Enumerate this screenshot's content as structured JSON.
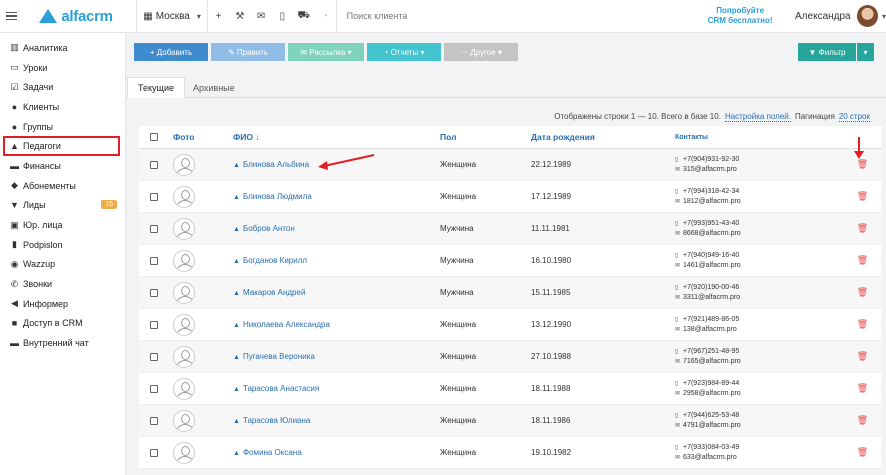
{
  "topbar": {
    "logo": "alfacrm",
    "city": "Москва",
    "search_placeholder": "Поиск клиента",
    "promo_line1": "Попробуйте",
    "promo_line2": "CRM бесплатно!",
    "user": "Александра",
    "icons": [
      "plus-icon",
      "wrench-icon",
      "mail-icon",
      "phone-icon",
      "cart-icon",
      "bell-icon"
    ]
  },
  "sidebar": {
    "items": [
      {
        "label": "Аналитика",
        "icon": "bars-icon"
      },
      {
        "label": "Уроки",
        "icon": "book-icon"
      },
      {
        "label": "Задачи",
        "icon": "tasks-icon"
      },
      {
        "label": "Клиенты",
        "icon": "user-icon"
      },
      {
        "label": "Группы",
        "icon": "users-icon"
      },
      {
        "label": "Педагоги",
        "icon": "graduation-cap-icon"
      },
      {
        "label": "Финансы",
        "icon": "money-icon"
      },
      {
        "label": "Абонементы",
        "icon": "tag-icon"
      },
      {
        "label": "Лиды",
        "icon": "filter-icon",
        "badge": "15"
      },
      {
        "label": "Юр. лица",
        "icon": "briefcase-icon"
      },
      {
        "label": "Podpislon",
        "icon": "doc-icon"
      },
      {
        "label": "Wazzup",
        "icon": "whatsapp-icon"
      },
      {
        "label": "Звонки",
        "icon": "phone-icon"
      },
      {
        "label": "Информер",
        "icon": "bullhorn-icon"
      },
      {
        "label": "Доступ в CRM",
        "icon": "lock-icon"
      },
      {
        "label": "Внутренний чат",
        "icon": "chat-icon"
      }
    ]
  },
  "toolbar": {
    "add": "+ Добавить",
    "edit": "✎ Править",
    "mail": "✉ Рассылка ▾",
    "reports": "◔ Отчеты ▾",
    "other": "··· Другое ▾",
    "filter": "▼ Фильтр",
    "filter_dd": "▾"
  },
  "tabs": [
    "Текущие",
    "Архивные"
  ],
  "pagination": {
    "text": "Отображены строки 1 — 10. Всего в базе 10.",
    "fields_link": "Настройка полей.",
    "pag_label": "Пагинация",
    "pag_link": "20 строк"
  },
  "table": {
    "columns": [
      "Фото",
      "ФИО ↓",
      "Пол",
      "Дата рождения",
      "Контакты"
    ],
    "rows": [
      {
        "name": "Блинова Альбина",
        "sex": "Женщина",
        "birth": "22.12.1989",
        "phone": "+7(904)931-92-30",
        "email": "315@alfacrm.pro"
      },
      {
        "name": "Блинова Людмила",
        "sex": "Женщина",
        "birth": "17.12.1989",
        "phone": "+7(994)318-42-34",
        "email": "1812@alfacrm.pro"
      },
      {
        "name": "Бобров Антон",
        "sex": "Мужчина",
        "birth": "11.11.1981",
        "phone": "+7(993)951-43-40",
        "email": "8668@alfacrm.pro"
      },
      {
        "name": "Богданов Кирилл",
        "sex": "Мужчина",
        "birth": "16.10.1980",
        "phone": "+7(940)949-16-40",
        "email": "1461@alfacrm.pro"
      },
      {
        "name": "Макаров Андрей",
        "sex": "Мужчина",
        "birth": "15.11.1985",
        "phone": "+7(920)190-00-46",
        "email": "3311@alfacrm.pro"
      },
      {
        "name": "Николаева Александра",
        "sex": "Женщина",
        "birth": "13.12.1990",
        "phone": "+7(921)489-86-05",
        "email": "138@alfacrm.pro"
      },
      {
        "name": "Пугачева Вероника",
        "sex": "Женщина",
        "birth": "27.10.1988",
        "phone": "+7(967)251-48-95",
        "email": "7165@alfacrm.pro"
      },
      {
        "name": "Тарасова Анастасия",
        "sex": "Женщина",
        "birth": "18.11.1988",
        "phone": "+7(923)984-89-44",
        "email": "2958@alfacrm.pro"
      },
      {
        "name": "Тарасова Юлиана",
        "sex": "Женщина",
        "birth": "18.11.1986",
        "phone": "+7(944)625-53-48",
        "email": "4791@alfacrm.pro"
      },
      {
        "name": "Фомина Оксана",
        "sex": "Женщина",
        "birth": "19.10.1982",
        "phone": "+7(933)084-03-49",
        "email": "633@alfacrm.pro"
      }
    ]
  },
  "colors": {
    "accent": "#2a9fd8",
    "highlight": "#e31e24",
    "delete": "#e84b4b",
    "badge": "#f0ad4e"
  }
}
